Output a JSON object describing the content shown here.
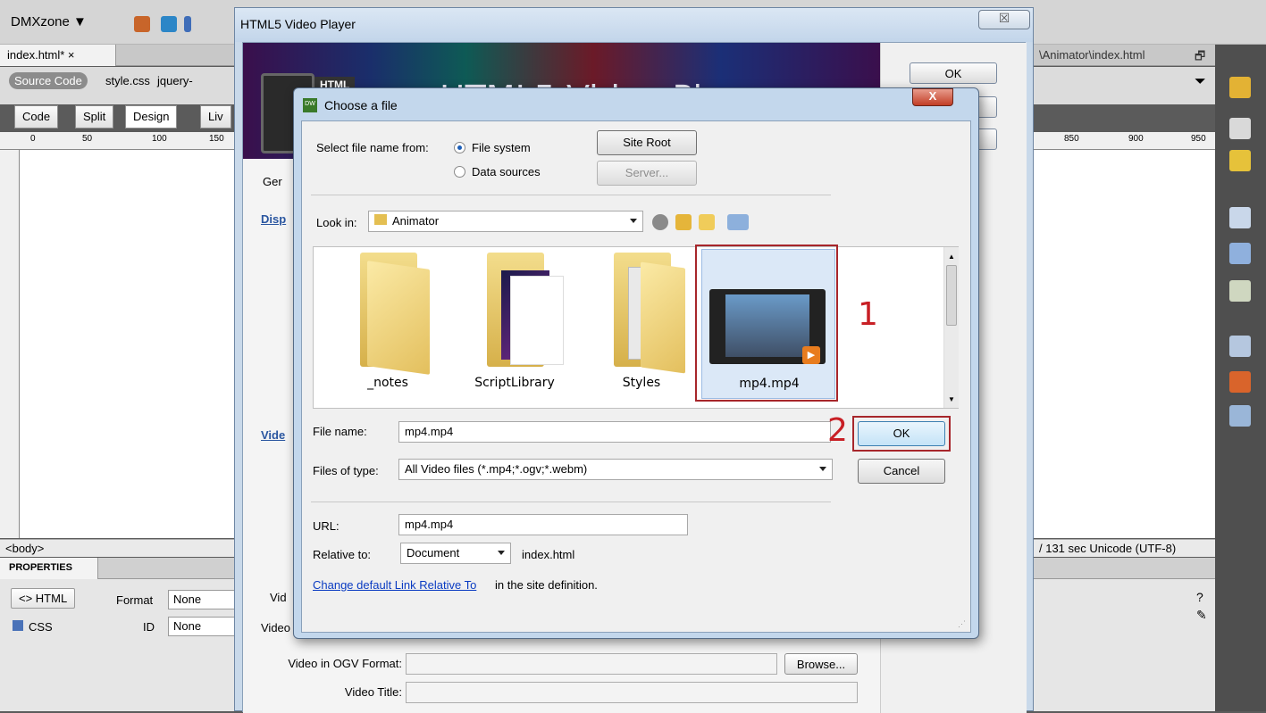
{
  "dreamweaver": {
    "menu_label": "DMXzone ▼",
    "doc_tab": "index.html*  ×",
    "related_files": [
      "Source Code",
      "style.css",
      "jquery-"
    ],
    "view_buttons": [
      "Code",
      "Split",
      "Design",
      "Liv"
    ],
    "ruler_marks": [
      "0",
      "50",
      "100",
      "150"
    ],
    "ruler_marks_right": [
      "850",
      "900",
      "950"
    ],
    "path_right": "\\Animator\\index.html",
    "status_tag": "<body>",
    "status_right": "/ 131 sec  Unicode (UTF-8)",
    "properties_title": "PROPERTIES",
    "html_button": "HTML",
    "css_button": "CSS",
    "format_label": "Format",
    "format_value": "None",
    "id_label": "ID",
    "id_value": "None"
  },
  "video_player": {
    "title": "HTML5 Video Player",
    "close_label": "☒",
    "banner_title": "HTML5 Video Player",
    "banner_badge": "HTML",
    "tab_general": "Ger",
    "section_display": "Disp",
    "section_video": "Vide",
    "side_buttons": [
      "OK",
      "el",
      "p"
    ],
    "row_labels": [
      "Vid",
      "Video",
      "Video in OGV Format:",
      "Video Title:"
    ],
    "browse_label": "Browse..."
  },
  "choose_file": {
    "title": "Choose a file",
    "title_icon_text": "DW",
    "close_label": "X",
    "select_from_label": "Select file name from:",
    "radio_file_system": "File system",
    "radio_data_sources": "Data sources",
    "site_root_button": "Site Root",
    "server_button": "Server...",
    "look_in_label": "Look in:",
    "look_in_value": "Animator",
    "files": [
      {
        "name": "_notes",
        "kind": "folder"
      },
      {
        "name": "ScriptLibrary",
        "kind": "folder"
      },
      {
        "name": "Styles",
        "kind": "folder"
      },
      {
        "name": "mp4.mp4",
        "kind": "video"
      }
    ],
    "callout_1": "1",
    "callout_2": "2",
    "file_name_label": "File name:",
    "file_name_value": "mp4.mp4",
    "files_of_type_label": "Files of type:",
    "files_of_type_value": "All Video files (*.mp4;*.ogv;*.webm)",
    "ok_button": "OK",
    "cancel_button": "Cancel",
    "url_label": "URL:",
    "url_value": "mp4.mp4",
    "relative_to_label": "Relative to:",
    "relative_to_value": "Document",
    "relative_to_file": "index.html",
    "change_link_text": "Change default Link Relative To",
    "change_link_suffix": "in the site definition."
  },
  "colors": {
    "highlight_red": "#a7262b",
    "callout_red": "#c81f25",
    "link_blue": "#0a3bc2"
  }
}
